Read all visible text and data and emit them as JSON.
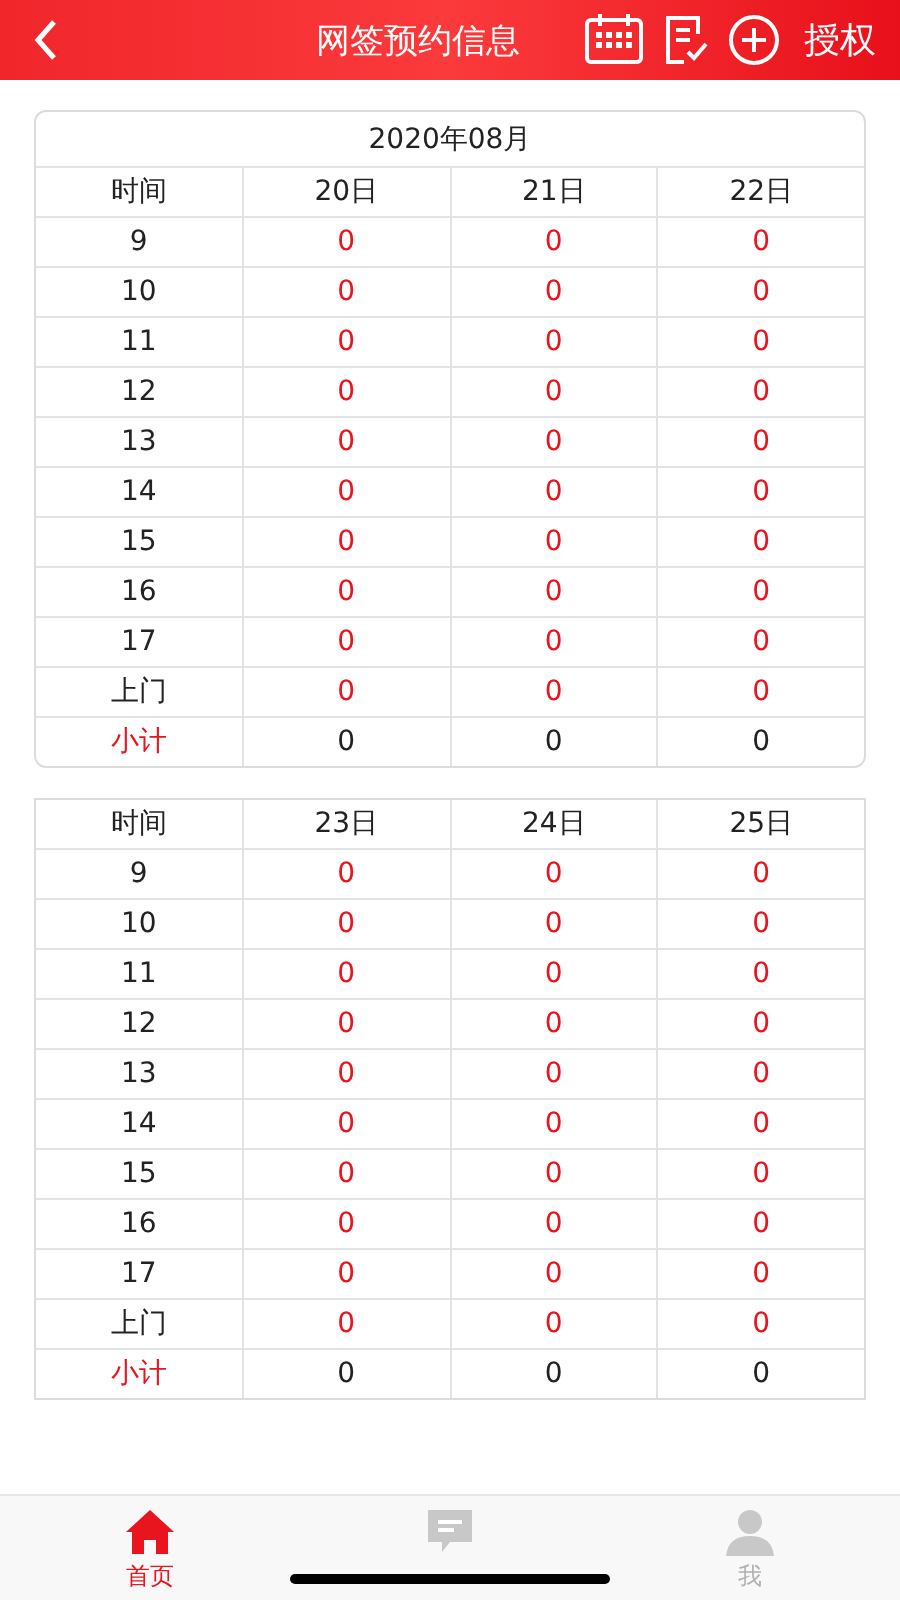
{
  "header": {
    "title": "网签预约信息",
    "action": "授权"
  },
  "tables": [
    {
      "caption": "2020年08月",
      "columns": [
        "时间",
        "20日",
        "21日",
        "22日"
      ],
      "rows": [
        {
          "kind": "hour",
          "cells": [
            "9",
            "0",
            "0",
            "0"
          ]
        },
        {
          "kind": "hour",
          "cells": [
            "10",
            "0",
            "0",
            "0"
          ]
        },
        {
          "kind": "hour",
          "cells": [
            "11",
            "0",
            "0",
            "0"
          ]
        },
        {
          "kind": "hour",
          "cells": [
            "12",
            "0",
            "0",
            "0"
          ]
        },
        {
          "kind": "hour",
          "cells": [
            "13",
            "0",
            "0",
            "0"
          ]
        },
        {
          "kind": "hour",
          "cells": [
            "14",
            "0",
            "0",
            "0"
          ]
        },
        {
          "kind": "hour",
          "cells": [
            "15",
            "0",
            "0",
            "0"
          ]
        },
        {
          "kind": "hour",
          "cells": [
            "16",
            "0",
            "0",
            "0"
          ]
        },
        {
          "kind": "hour",
          "cells": [
            "17",
            "0",
            "0",
            "0"
          ]
        },
        {
          "kind": "hour",
          "cells": [
            "上门",
            "0",
            "0",
            "0"
          ]
        },
        {
          "kind": "subtotal",
          "cells": [
            "小计",
            "0",
            "0",
            "0"
          ]
        }
      ]
    },
    {
      "columns": [
        "时间",
        "23日",
        "24日",
        "25日"
      ],
      "rows": [
        {
          "kind": "hour",
          "cells": [
            "9",
            "0",
            "0",
            "0"
          ]
        },
        {
          "kind": "hour",
          "cells": [
            "10",
            "0",
            "0",
            "0"
          ]
        },
        {
          "kind": "hour",
          "cells": [
            "11",
            "0",
            "0",
            "0"
          ]
        },
        {
          "kind": "hour",
          "cells": [
            "12",
            "0",
            "0",
            "0"
          ]
        },
        {
          "kind": "hour",
          "cells": [
            "13",
            "0",
            "0",
            "0"
          ]
        },
        {
          "kind": "hour",
          "cells": [
            "14",
            "0",
            "0",
            "0"
          ]
        },
        {
          "kind": "hour",
          "cells": [
            "15",
            "0",
            "0",
            "0"
          ]
        },
        {
          "kind": "hour",
          "cells": [
            "16",
            "0",
            "0",
            "0"
          ]
        },
        {
          "kind": "hour",
          "cells": [
            "17",
            "0",
            "0",
            "0"
          ]
        },
        {
          "kind": "hour",
          "cells": [
            "上门",
            "0",
            "0",
            "0"
          ]
        },
        {
          "kind": "subtotal",
          "cells": [
            "小计",
            "0",
            "0",
            "0"
          ]
        }
      ]
    }
  ],
  "tab_bar": [
    {
      "kind": "home",
      "label": "首页",
      "selected": true
    },
    {
      "kind": "message",
      "selected": false
    },
    {
      "kind": "me",
      "label": "我",
      "selected": false
    }
  ]
}
